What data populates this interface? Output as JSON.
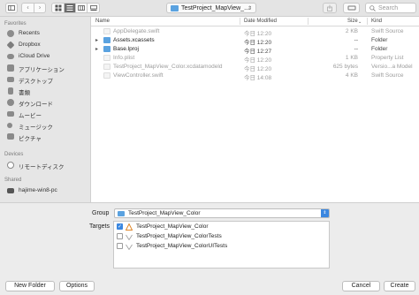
{
  "toolbar": {
    "path_title": "TestProject_MapView_...",
    "search_placeholder": "Search"
  },
  "sidebar": {
    "favorites_header": "Favorites",
    "favorites": [
      {
        "label": "Recents",
        "icon": "clock-icon"
      },
      {
        "label": "Dropbox",
        "icon": "dropbox-icon"
      },
      {
        "label": "iCloud Drive",
        "icon": "cloud-icon"
      },
      {
        "label": "アプリケーション",
        "icon": "applications-icon"
      },
      {
        "label": "デスクトップ",
        "icon": "desktop-icon"
      },
      {
        "label": "書類",
        "icon": "document-icon"
      },
      {
        "label": "ダウンロード",
        "icon": "download-icon"
      },
      {
        "label": "ムービー",
        "icon": "movie-icon"
      },
      {
        "label": "ミュージック",
        "icon": "music-icon"
      },
      {
        "label": "ピクチャ",
        "icon": "picture-icon"
      }
    ],
    "devices_header": "Devices",
    "devices": [
      {
        "label": "リモートディスク",
        "icon": "disc-icon"
      }
    ],
    "shared_header": "Shared",
    "shared": [
      {
        "label": "hajime-win8-pc",
        "icon": "pc-icon"
      }
    ]
  },
  "columns": {
    "name": "Name",
    "date": "Date Modified",
    "size": "Size",
    "kind": "Kind"
  },
  "files": [
    {
      "name": "AppDelegate.swift",
      "date": "今日 12:20",
      "size": "2 KB",
      "kind": "Swift Source",
      "dim": true,
      "folder": false
    },
    {
      "name": "Assets.xcassets",
      "date": "今日 12:20",
      "size": "--",
      "kind": "Folder",
      "dim": false,
      "folder": true
    },
    {
      "name": "Base.lproj",
      "date": "今日 12:27",
      "size": "--",
      "kind": "Folder",
      "dim": false,
      "folder": true
    },
    {
      "name": "Info.plist",
      "date": "今日 12:20",
      "size": "1 KB",
      "kind": "Property List",
      "dim": true,
      "folder": false
    },
    {
      "name": "TestProject_MapView_Color.xcdatamodeld",
      "date": "今日 12:20",
      "size": "625 bytes",
      "kind": "Versio...a Model",
      "dim": true,
      "folder": false
    },
    {
      "name": "ViewController.swift",
      "date": "今日 14:08",
      "size": "4 KB",
      "kind": "Swift Source",
      "dim": true,
      "folder": false
    }
  ],
  "save_panel": {
    "group_label": "Group",
    "group_value": "TestProject_MapView_Color",
    "targets_label": "Targets",
    "targets": [
      {
        "label": "TestProject_MapView_Color",
        "checked": true,
        "icon": "app-target-icon"
      },
      {
        "label": "TestProject_MapView_ColorTests",
        "checked": false,
        "icon": "test-target-icon"
      },
      {
        "label": "TestProject_MapView_ColorUITests",
        "checked": false,
        "icon": "test-target-icon"
      }
    ]
  },
  "buttons": {
    "new_folder": "New Folder",
    "options": "Options",
    "cancel": "Cancel",
    "create": "Create"
  },
  "colors": {
    "accent": "#3b87e0",
    "folder": "#5aa2e0"
  }
}
